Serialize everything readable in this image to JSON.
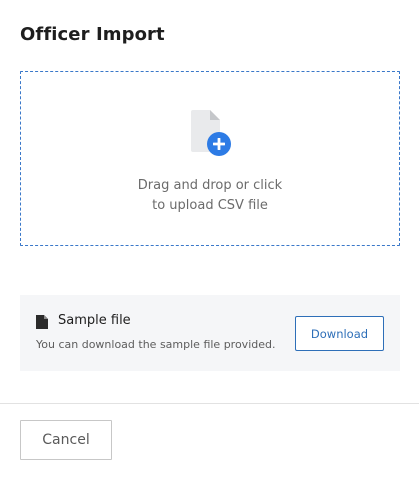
{
  "modal": {
    "title": "Officer Import"
  },
  "dropzone": {
    "line1": "Drag and drop or click",
    "line2": "to upload CSV file",
    "icon": "file-add-icon",
    "accent_color": "#3a78c9",
    "badge_color": "#2d7be5"
  },
  "sample": {
    "title": "Sample file",
    "description": "You can download the sample file provided.",
    "icon": "document-icon",
    "download_label": "Download"
  },
  "footer": {
    "cancel_label": "Cancel"
  }
}
